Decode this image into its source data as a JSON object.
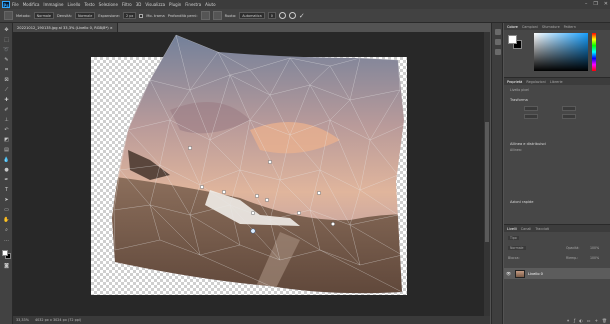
{
  "app": {
    "logo": "Ps",
    "menus": [
      "File",
      "Modifica",
      "Immagine",
      "Livello",
      "Testo",
      "Selezione",
      "Filtro",
      "3D",
      "Visualizza",
      "Plugin",
      "Finestra",
      "Aiuto"
    ]
  },
  "options_bar": {
    "metodo_label": "Metodo:",
    "metodo_value": "Normale",
    "densita_label": "Densità:",
    "densita_value": "Normale",
    "espansione_label": "Espansione:",
    "espansione_value": "2 px",
    "mostra_mesh_label": "Mo. trama",
    "profondita_label": "Profondità perni:",
    "rotazione_label": "Ruota:",
    "rotazione_value": "Automatica",
    "angolo_value": "0"
  },
  "document": {
    "tab_title": "20221012_190135.jpg al 33,3% (Livello 0, RGB/8*) ×",
    "zoom": "33,33%",
    "doc_info": "4032 px x 3024 px (72 ppi)"
  },
  "panels": {
    "color_tabs": [
      "Colore",
      "Campioni",
      "Sfumature",
      "Pattern"
    ],
    "properties_tabs": [
      "Proprietà",
      "Regolazioni",
      "Librerie"
    ],
    "layer_type": "Livello pixel",
    "transform_title": "Trasforma",
    "align_title": "Allinea e distribuisci",
    "align_label": "Allinea:",
    "quick_actions_title": "Azioni rapide",
    "layers_tabs": [
      "Livelli",
      "Canali",
      "Tracciati"
    ],
    "blend_mode": "Normale",
    "opacity_label": "Opacità:",
    "opacity_value": "100%",
    "lock_label": "Blocca:",
    "fill_label": "Riemp.:",
    "fill_value": "100%",
    "layer_name": "Livello 0",
    "search_placeholder": "Tipo"
  },
  "colors": {
    "accent": "#31a8ff",
    "panel_bg": "#474747",
    "doc_bg": "#282828"
  }
}
